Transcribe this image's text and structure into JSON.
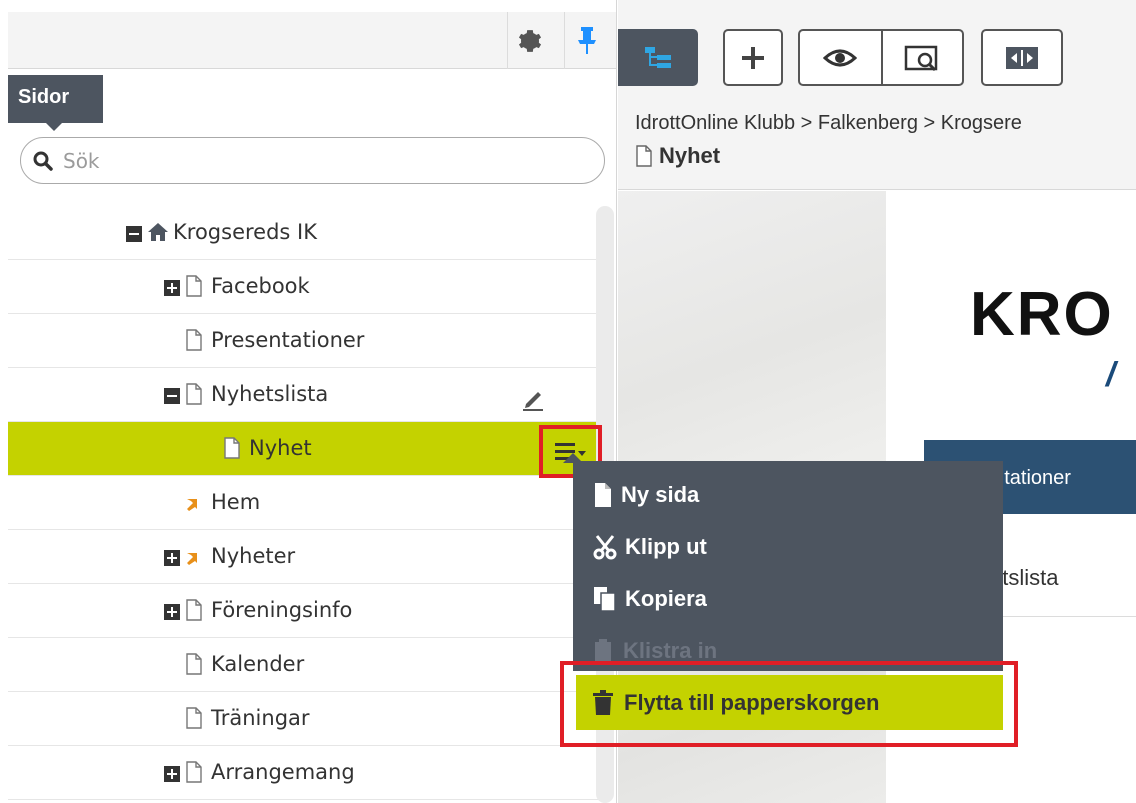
{
  "left_panel": {
    "tab_label": "Sidor",
    "search": {
      "placeholder": "Sök"
    },
    "tree": [
      {
        "label": "Krogsereds IK",
        "icon": "house-icon",
        "expander": "minus"
      },
      {
        "label": "Facebook",
        "icon": "page-icon",
        "expander": "plus"
      },
      {
        "label": "Presentationer",
        "icon": "page-icon",
        "expander": "none"
      },
      {
        "label": "Nyhetslista",
        "icon": "page-icon",
        "expander": "minus"
      },
      {
        "label": "Nyhet",
        "icon": "page-icon",
        "expander": "none",
        "selected": true
      },
      {
        "label": "Hem",
        "icon": "shortcut-icon",
        "expander": "none"
      },
      {
        "label": "Nyheter",
        "icon": "shortcut-icon",
        "expander": "plus"
      },
      {
        "label": "Föreningsinfo",
        "icon": "page-icon",
        "expander": "plus"
      },
      {
        "label": "Kalender",
        "icon": "page-icon",
        "expander": "none"
      },
      {
        "label": "Träningar",
        "icon": "page-icon",
        "expander": "none"
      },
      {
        "label": "Arrangemang",
        "icon": "page-icon",
        "expander": "plus"
      }
    ]
  },
  "context_menu": {
    "items": [
      {
        "label": "Ny sida",
        "icon": "new-page-icon",
        "enabled": true
      },
      {
        "label": "Klipp ut",
        "icon": "scissors-icon",
        "enabled": true
      },
      {
        "label": "Kopiera",
        "icon": "copy-icon",
        "enabled": true
      },
      {
        "label": "Klistra in",
        "icon": "paste-icon",
        "enabled": false
      },
      {
        "label": "Flytta till papperskorgen",
        "icon": "trash-icon",
        "enabled": true,
        "highlighted": true
      }
    ]
  },
  "right_panel": {
    "breadcrumb": "IdrottOnline Klubb > Falkenberg > Krogsere",
    "page_name": "Nyhet",
    "preview": {
      "logo_text": "KRO",
      "logo_sub": "/",
      "nav_item": "entationer",
      "sub_item": "etslista"
    }
  },
  "colors": {
    "accent": "#c4d200",
    "dark": "#4d5560",
    "pin": "#1e90ff",
    "highlight": "#e01e26",
    "site_nav": "#2c5173",
    "shortcut": "#e8901a"
  }
}
